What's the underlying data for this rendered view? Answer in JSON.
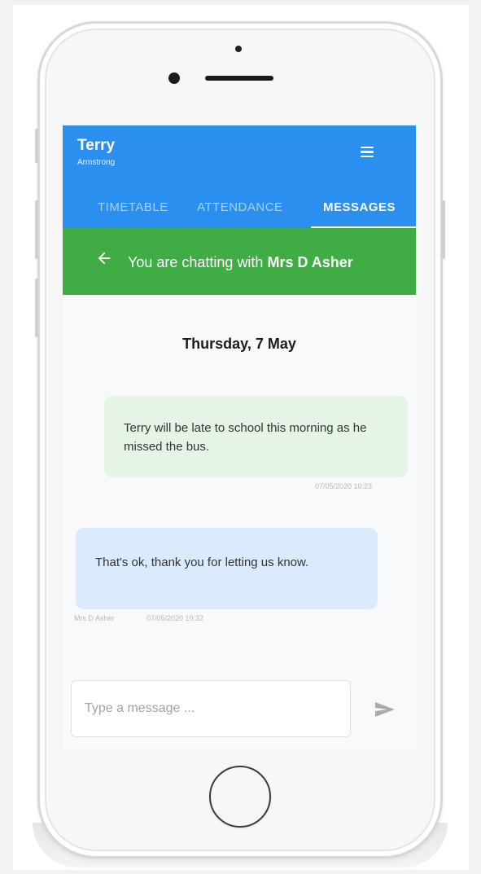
{
  "app": {
    "user": {
      "first_name": "Terry",
      "last_name": "Armstrong"
    },
    "tabs": [
      {
        "label": "TIMETABLE",
        "active": false
      },
      {
        "label": "ATTENDANCE",
        "active": false
      },
      {
        "label": "MESSAGES",
        "active": true
      }
    ],
    "chat_header": {
      "prefix": "You are chatting with ",
      "contact_name": "Mrs D Asher"
    },
    "date_heading": "Thursday, 7 May",
    "messages": [
      {
        "direction": "sent",
        "text": "Terry will be late to school this morning as he missed the bus.",
        "timestamp": "07/05/2020 10:23"
      },
      {
        "direction": "received",
        "text": "That's ok, thank you for letting us know.",
        "sender": "Mrs D Asher",
        "timestamp": "07/05/2020 10:32"
      }
    ],
    "composer": {
      "placeholder": "Type a message ...",
      "value": ""
    }
  },
  "colors": {
    "app_bar": "#2b8fef",
    "chat_bar": "#3fac46",
    "sent_bubble": "#e5f4e7",
    "received_bubble": "#d9ebfd",
    "tab_inactive_text": "#a9d2fb"
  },
  "icons": {
    "menu": "hamburger-menu-icon",
    "back": "back-arrow-icon",
    "send": "send-icon"
  }
}
